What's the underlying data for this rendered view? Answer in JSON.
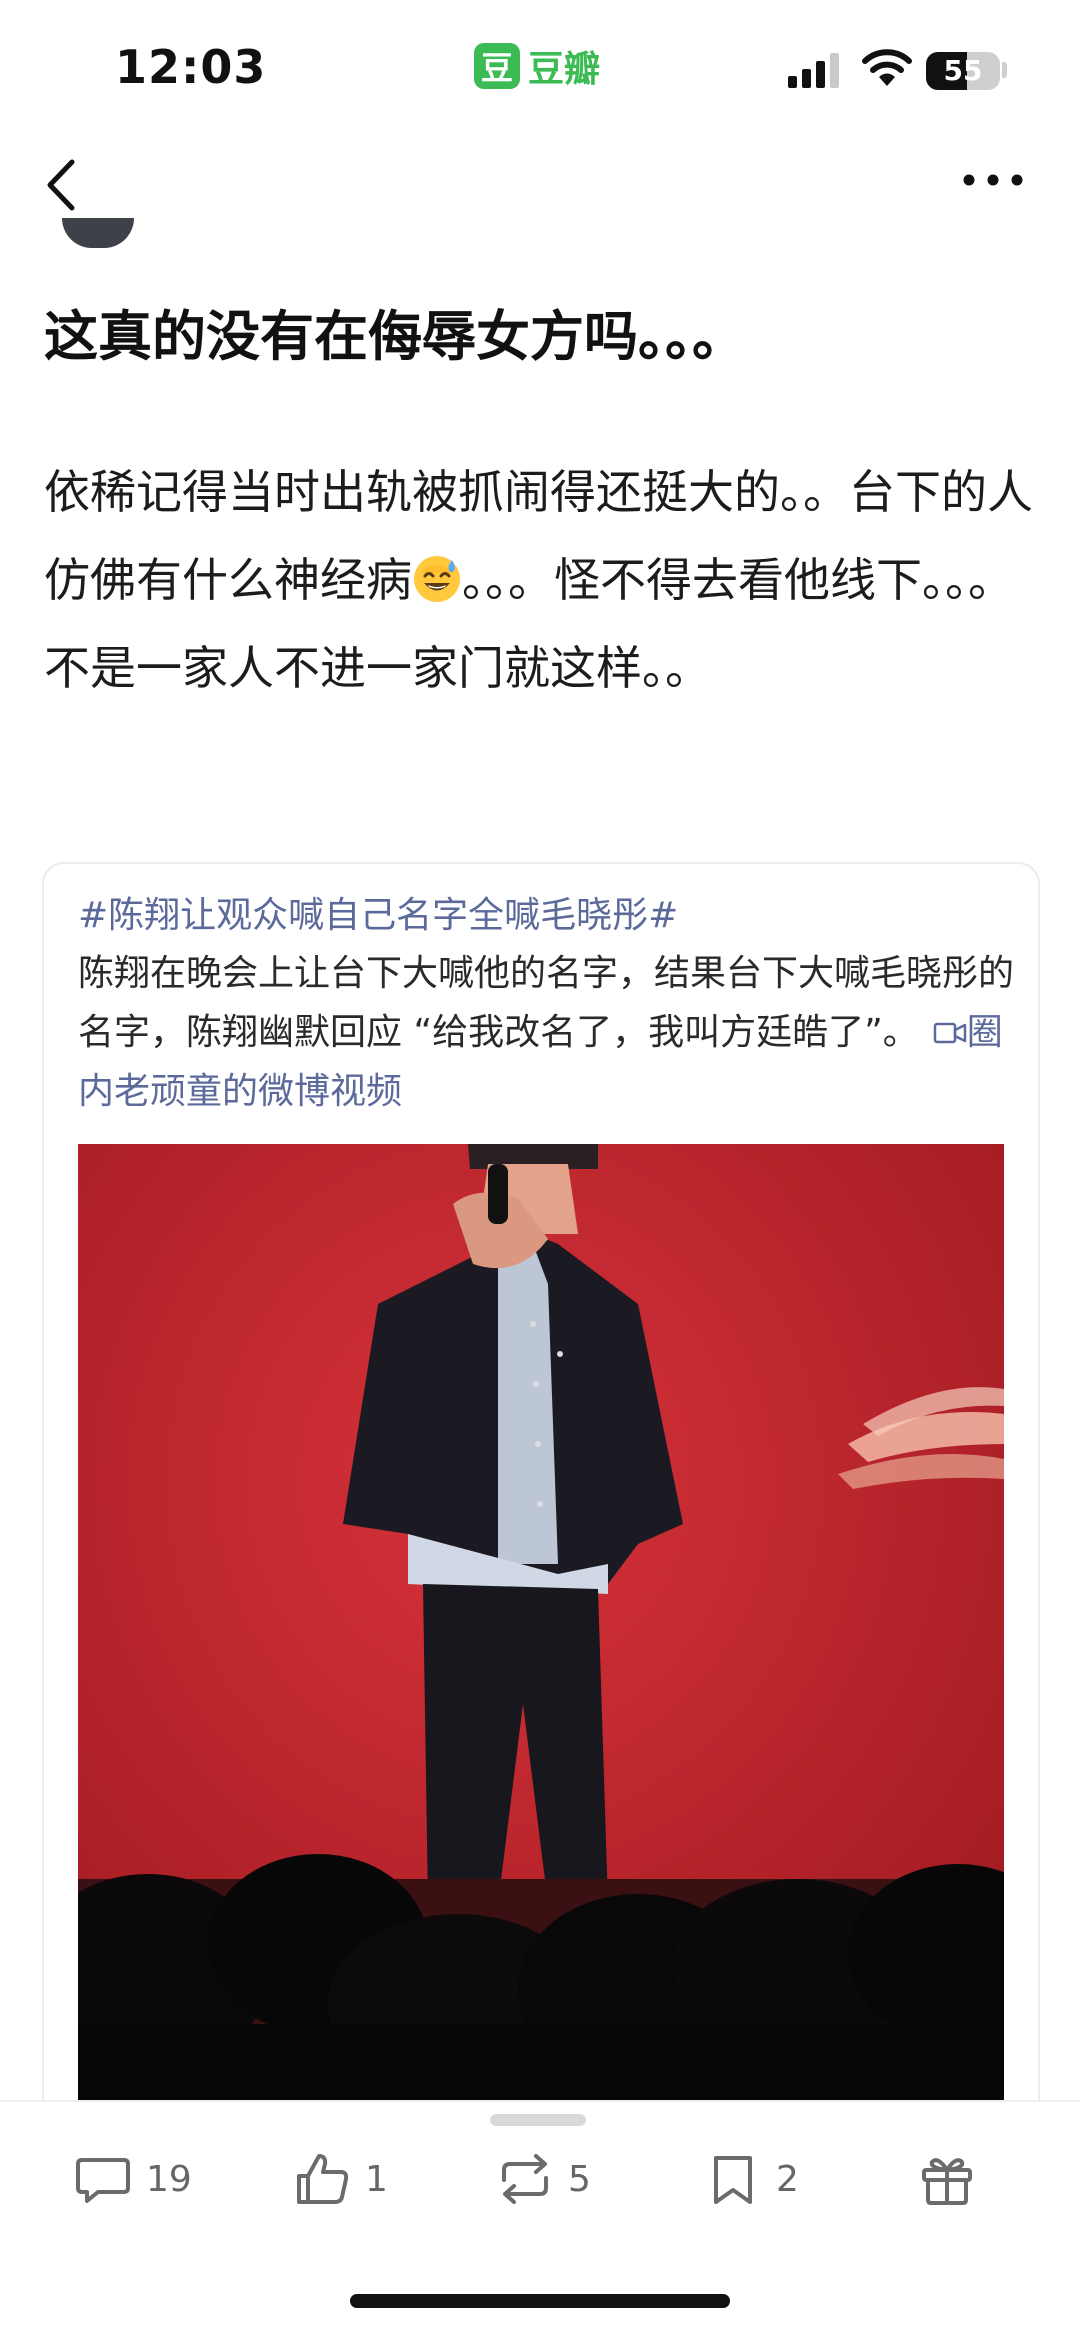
{
  "status_bar": {
    "time": "12:03",
    "app_logo_char": "豆",
    "app_name": "豆瓣",
    "battery_percent": 55,
    "battery_label": "55",
    "signal_strength": "3 of 4 bars",
    "icons": [
      "signal-icon",
      "wifi-icon",
      "battery-icon"
    ]
  },
  "nav": {
    "back_icon": "chevron-left-icon",
    "more_icon": "more-horizontal-icon"
  },
  "post": {
    "title": "这真的没有在侮辱女方吗。。。",
    "body_part1": "依稀记得当时出轨被抓闹得还挺大的。。台下的人仿佛有什么神经病",
    "emoji": "😅",
    "body_part2": "。。。怪不得去看他线下。。。不是一家人不进一家门就这样。。"
  },
  "quote": {
    "hashtag": "#陈翔让观众喊自己名字全喊毛晓彤#",
    "text": "陈翔在晚会上让台下大喊他的名字，结果台下大喊毛晓彤的名字，陈翔幽默回应 “给我改名了，我叫方廷皓了”。",
    "link_icon": "video-link-icon",
    "link_text": "圈内老顽童的微博视频"
  },
  "actions": {
    "comments": {
      "icon": "comment-icon",
      "count": "19"
    },
    "likes": {
      "icon": "thumbs-up-icon",
      "count": "1"
    },
    "reshares": {
      "icon": "repost-icon",
      "count": "5"
    },
    "collects": {
      "icon": "bookmark-icon",
      "count": "2"
    },
    "gift": {
      "icon": "gift-icon"
    }
  },
  "colors": {
    "brand_green": "#3cba54",
    "link_blue": "#5b6a9a",
    "stage_red": "#c3242b"
  }
}
